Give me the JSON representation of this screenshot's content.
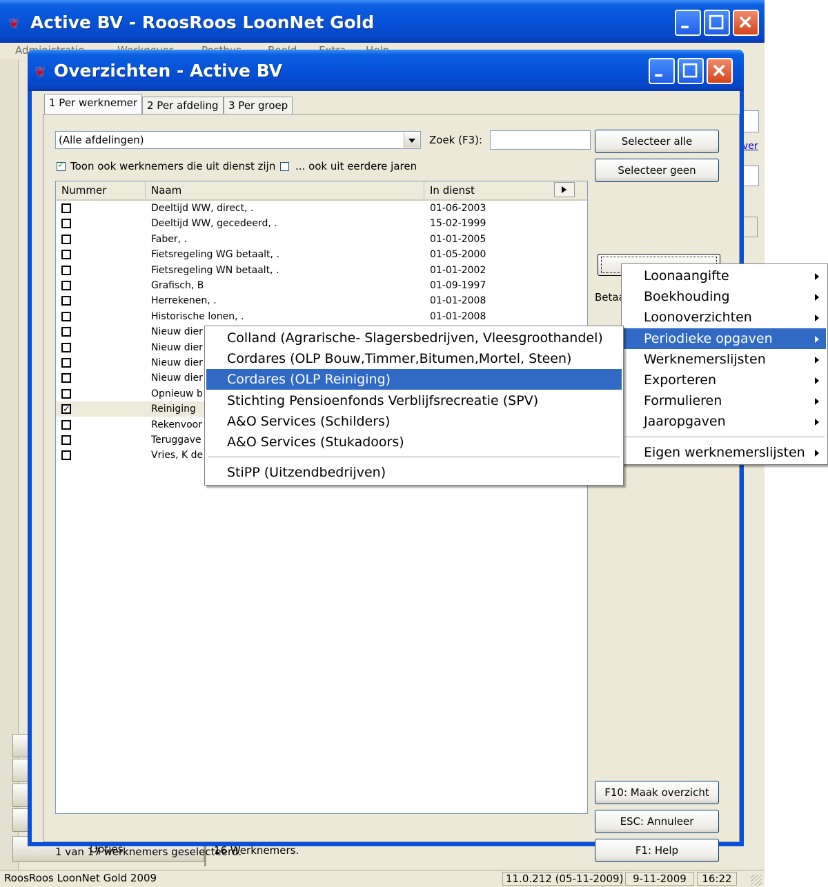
{
  "main_window": {
    "title": "Active BV - RoosRoos LoonNet Gold",
    "menu": [
      "Administratie",
      "Werkgever",
      "Postbus",
      "Beeld",
      "Extra",
      "Help"
    ],
    "options_label": "Opties",
    "employee_count_text": "16 Werknemers.",
    "behind_link": "ver",
    "status": {
      "app_name": "RoosRoos LoonNet Gold 2009",
      "version": "11.0.212 (05-11-2009)",
      "date": "9-11-2009",
      "time": "16:22"
    }
  },
  "dialog": {
    "title": "Overzichten - Active BV",
    "tabs": [
      {
        "label": "1 Per werknemer",
        "active": true
      },
      {
        "label": "2 Per afdeling",
        "active": false
      },
      {
        "label": "3 Per groep",
        "active": false
      }
    ],
    "department_select": "(Alle afdelingen)",
    "search_label": "Zoek (F3):",
    "search_value": "",
    "checkbox_out_of_service": {
      "label": "Toon ook werknemers die uit dienst zijn",
      "checked": true
    },
    "checkbox_previous_years": {
      "label": "... ook uit eerdere jaren",
      "checked": false
    },
    "buttons": {
      "select_all": "Selecteer alle",
      "select_none": "Selecteer geen",
      "make_overview": "F10: Maak overzicht",
      "cancel": "ESC: Annuleer",
      "help": "F1: Help"
    },
    "betaal_label": "Betaa",
    "list": {
      "columns": [
        "Nummer",
        "Naam",
        "In dienst"
      ],
      "rows": [
        {
          "name": "Deeltijd WW, direct, .",
          "date": "01-06-2003",
          "checked": false
        },
        {
          "name": "Deeltijd WW, gecedeerd, .",
          "date": "15-02-1999",
          "checked": false
        },
        {
          "name": "Faber, .",
          "date": "01-01-2005",
          "checked": false
        },
        {
          "name": "Fietsregeling WG betaalt, .",
          "date": "01-05-2000",
          "checked": false
        },
        {
          "name": "Fietsregeling WN betaalt, .",
          "date": "01-01-2002",
          "checked": false
        },
        {
          "name": "Grafisch, B",
          "date": "01-09-1997",
          "checked": false
        },
        {
          "name": "Herrekenen, .",
          "date": "01-01-2008",
          "checked": false
        },
        {
          "name": "Historische lonen, .",
          "date": "01-01-2008",
          "checked": false
        },
        {
          "name": "Nieuw dier",
          "date": "",
          "checked": false
        },
        {
          "name": "Nieuw dier",
          "date": "",
          "checked": false
        },
        {
          "name": "Nieuw dier",
          "date": "",
          "checked": false
        },
        {
          "name": "Nieuw dier",
          "date": "",
          "checked": false
        },
        {
          "name": "Opnieuw b",
          "date": "",
          "checked": false
        },
        {
          "name": "Reiniging",
          "date": "",
          "checked": true,
          "selected": true
        },
        {
          "name": "Rekenvoor",
          "date": "",
          "checked": false
        },
        {
          "name": "Teruggave",
          "date": "",
          "checked": false
        },
        {
          "name": "Vries, K de",
          "date": "",
          "checked": false
        }
      ]
    },
    "selection_status": "1 van 17 werknemers geselecteerd."
  },
  "menus": {
    "main_menu": [
      {
        "label": "Loonaangifte",
        "submenu": true
      },
      {
        "label": "Boekhouding",
        "submenu": true
      },
      {
        "label": "Loonoverzichten",
        "submenu": true
      },
      {
        "label": "Periodieke opgaven",
        "submenu": true,
        "highlight": true
      },
      {
        "label": "Werknemerslijsten",
        "submenu": true
      },
      {
        "label": "Exporteren",
        "submenu": true
      },
      {
        "label": "Formulieren",
        "submenu": true
      },
      {
        "label": "Jaaropgaven",
        "submenu": true
      },
      {
        "label": "Eigen werknemerslijsten",
        "submenu": true,
        "separator_before": true
      }
    ],
    "sub_menu": [
      {
        "label": "Colland (Agrarische- Slagersbedrijven, Vleesgroothandel)"
      },
      {
        "label": "Cordares (OLP Bouw,Timmer,Bitumen,Mortel, Steen)"
      },
      {
        "label": "Cordares (OLP Reiniging)",
        "highlight": true
      },
      {
        "label": "Stichting Pensioenfonds Verblijfsrecreatie (SPV)"
      },
      {
        "label": "A&O Services (Schilders)"
      },
      {
        "label": "A&O Services (Stukadoors)"
      },
      {
        "label": "StiPP (Uitzendbedrijven)",
        "separator_before": true
      }
    ]
  },
  "colors": {
    "title_blue": "#0652d8",
    "menu_highlight": "#316ac5",
    "window_face": "#ece9d8"
  }
}
